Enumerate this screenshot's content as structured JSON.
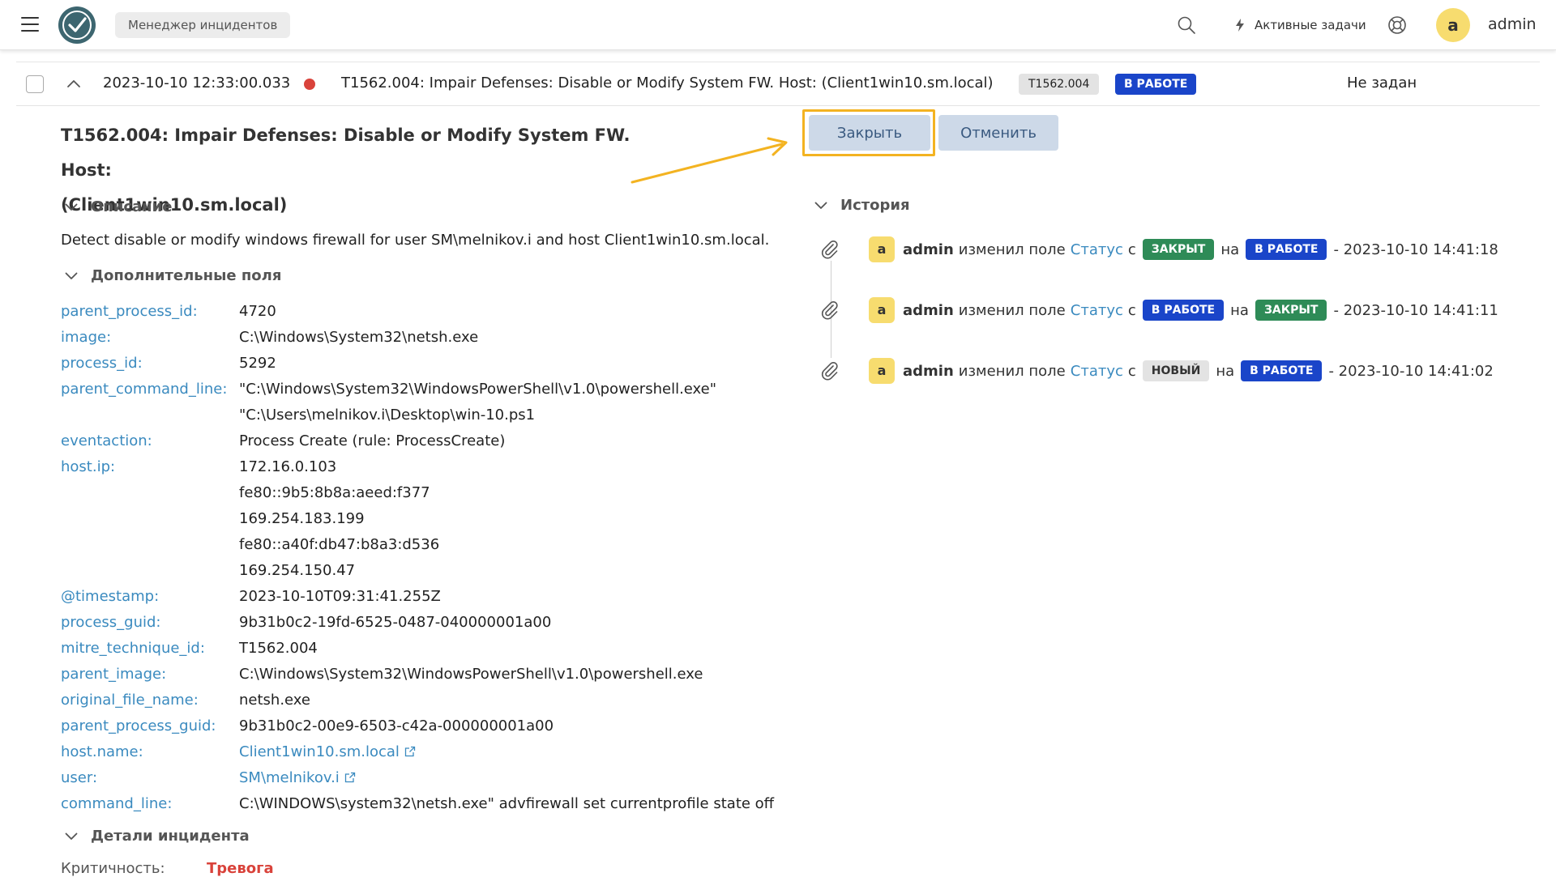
{
  "topbar": {
    "app_name": "Менеджер инцидентов",
    "active_tasks": "Активные задачи",
    "avatar_letter": "a",
    "user": "admin"
  },
  "incident_row": {
    "date": "2023-10-10 12:33:00.033",
    "title": "T1562.004: Impair Defenses: Disable or Modify System FW. Host: (Client1win10.sm.local)",
    "tag": "T1562.004",
    "status": "В РАБОТЕ",
    "assignee": "Не задан",
    "severity_color": "#d9433b"
  },
  "detail": {
    "title_line1": "T1562.004: Impair Defenses: Disable or Modify System FW. Host:",
    "title_line2": "(Client1win10.sm.local)",
    "sections": {
      "description": "Описание",
      "extra_fields": "Дополнительные поля",
      "incident_details": "Детали инцидента"
    },
    "description_text": "Detect disable or modify windows firewall for user SM\\melnikov.i and host Client1win10.sm.local.",
    "fields": [
      {
        "key": "parent_process_id:",
        "value": "4720"
      },
      {
        "key": "image:",
        "value": "C:\\Windows\\System32\\netsh.exe"
      },
      {
        "key": "process_id:",
        "value": "5292"
      },
      {
        "key": "parent_command_line:",
        "value": "\"C:\\Windows\\System32\\WindowsPowerShell\\v1.0\\powershell.exe\""
      },
      {
        "key": "",
        "value": "\"C:\\Users\\melnikov.i\\Desktop\\win-10.ps1"
      },
      {
        "key": "eventaction:",
        "value": "Process Create (rule: ProcessCreate)"
      },
      {
        "key": "host.ip:",
        "value": "172.16.0.103"
      },
      {
        "key": "",
        "value": "fe80::9b5:8b8a:aeed:f377"
      },
      {
        "key": "",
        "value": "169.254.183.199"
      },
      {
        "key": "",
        "value": "fe80::a40f:db47:b8a3:d536"
      },
      {
        "key": "",
        "value": "169.254.150.47"
      },
      {
        "key": "@timestamp:",
        "value": "2023-10-10T09:31:41.255Z"
      },
      {
        "key": "process_guid:",
        "value": "9b31b0c2-19fd-6525-0487-040000001a00"
      },
      {
        "key": "mitre_technique_id:",
        "value": "T1562.004"
      },
      {
        "key": "parent_image:",
        "value": "C:\\Windows\\System32\\WindowsPowerShell\\v1.0\\powershell.exe"
      },
      {
        "key": "original_file_name:",
        "value": "netsh.exe"
      },
      {
        "key": "parent_process_guid:",
        "value": "9b31b0c2-00e9-6503-c42a-000000001a00"
      },
      {
        "key": "host.name:",
        "value": "Client1win10.sm.local"
      },
      {
        "key": "user:",
        "value": "SM\\melnikov.i"
      },
      {
        "key": "command_line:",
        "value": "C:\\WINDOWS\\system32\\netsh.exe\" advfirewall set currentprofile state off"
      }
    ],
    "criticality_label": "Критичность:",
    "criticality_value": "Тревога"
  },
  "actions": {
    "close": "Закрыть",
    "cancel": "Отменить"
  },
  "history": {
    "title": "История",
    "items": [
      {
        "avatar": "a",
        "user": "admin",
        "action": "изменил поле",
        "field": "Статус",
        "from_word": "с",
        "from": "ЗАКРЫТ",
        "to_word": "на",
        "to": "В РАБОТЕ",
        "time": "- 2023-10-10 14:41:18"
      },
      {
        "avatar": "a",
        "user": "admin",
        "action": "изменил поле",
        "field": "Статус",
        "from_word": "с",
        "from": "В РАБОТЕ",
        "to_word": "на",
        "to": "ЗАКРЫТ",
        "time": "- 2023-10-10 14:41:11"
      },
      {
        "avatar": "a",
        "user": "admin",
        "action": "изменил поле",
        "field": "Статус",
        "from_word": "с",
        "from": "НОВЫЙ",
        "to_word": "на",
        "to": "В РАБОТЕ",
        "time": "- 2023-10-10 14:41:02"
      }
    ]
  },
  "colors": {
    "accent_blue": "#1a45c9",
    "closed_green": "#2e8b57",
    "highlight": "#f3b321",
    "link": "#3a8abf"
  }
}
